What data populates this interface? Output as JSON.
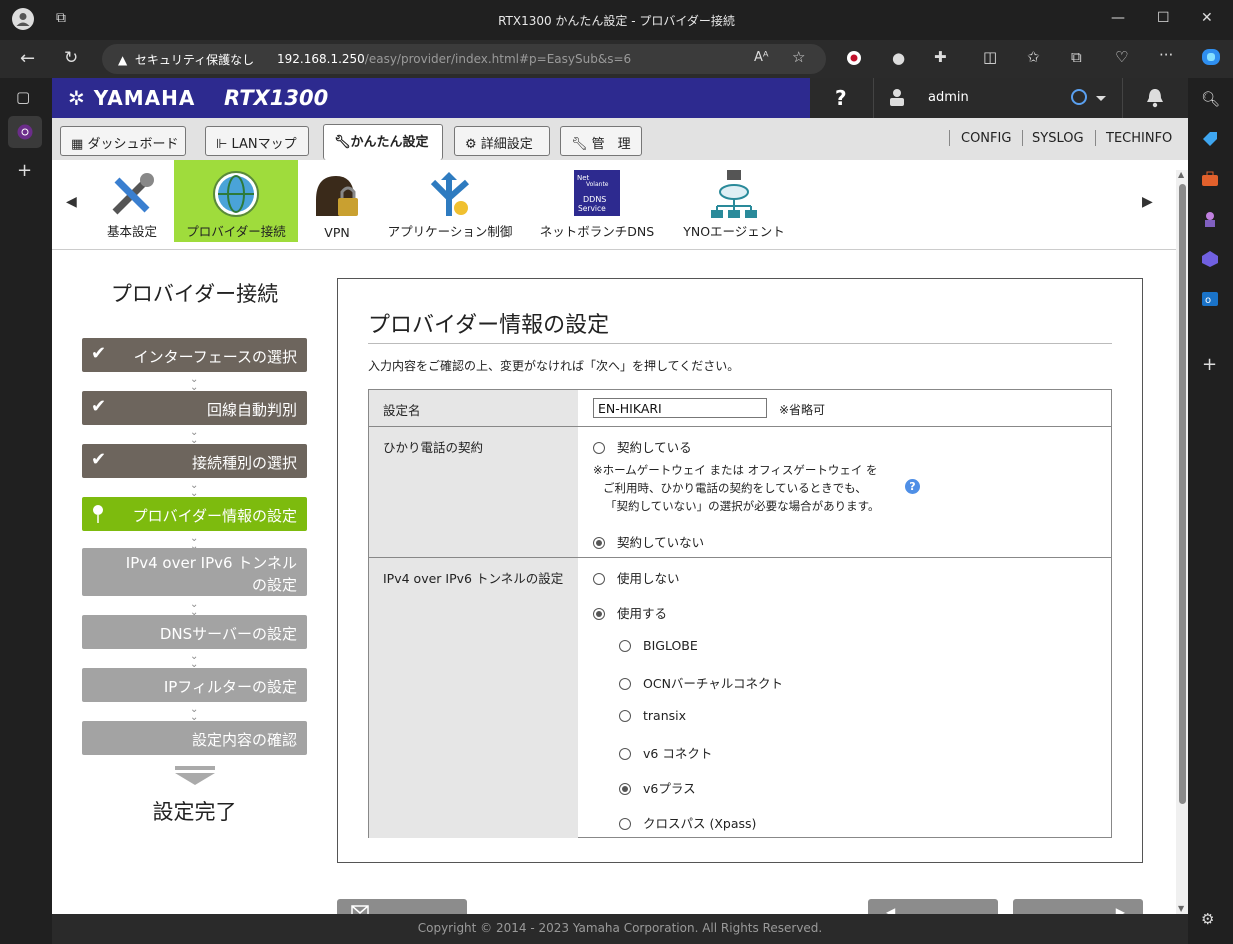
{
  "window": {
    "title": "RTX1300 かんたん設定 - プロバイダー接続"
  },
  "addressbar": {
    "security_warning": "セキュリティ保護なし",
    "url_host": "192.168.1.250",
    "url_path": "/easy/provider/index.html#p=EasySub&s=6"
  },
  "header": {
    "logo": "YAMAHA",
    "model": "RTX1300",
    "help_label": "?",
    "user": "admin"
  },
  "tabs": [
    {
      "label": "ダッシュボード"
    },
    {
      "label": "LANマップ"
    },
    {
      "label": "かんたん設定"
    },
    {
      "label": "詳細設定"
    },
    {
      "label": "管　理"
    }
  ],
  "toplinks": [
    "CONFIG",
    "SYSLOG",
    "TECHINFO"
  ],
  "functions": [
    {
      "label": "基本設定"
    },
    {
      "label": "プロバイダー接続"
    },
    {
      "label": "VPN"
    },
    {
      "label": "アプリケーション制御"
    },
    {
      "label": "ネットボランチDNS"
    },
    {
      "label": "YNOエージェント"
    }
  ],
  "ddns_icon_text": [
    "Net",
    "Volante",
    "DDNS",
    "Service"
  ],
  "sidebar": {
    "title": "プロバイダー接続",
    "steps": [
      {
        "label": "インターフェースの選択",
        "state": "done"
      },
      {
        "label": "回線自動判別",
        "state": "done"
      },
      {
        "label": "接続種別の選択",
        "state": "done"
      },
      {
        "label": "プロバイダー情報の設定",
        "state": "current"
      },
      {
        "label": "IPv4 over IPv6 トンネル",
        "label2": "の設定",
        "state": "todo"
      },
      {
        "label": "DNSサーバーの設定",
        "state": "todo"
      },
      {
        "label": "IPフィルターの設定",
        "state": "todo"
      },
      {
        "label": "設定内容の確認",
        "state": "todo"
      }
    ],
    "complete_label": "設定完了"
  },
  "panel": {
    "title": "プロバイダー情報の設定",
    "description": "入力内容をご確認の上、変更がなければ「次へ」を押してください。",
    "rows": {
      "name": {
        "label": "設定名",
        "value": "EN-HIKARI",
        "hint": "※省略可"
      },
      "hikari": {
        "label": "ひかり電話の契約",
        "opt_yes": "契約している",
        "note1": "※ホームゲートウェイ または オフィスゲートウェイ を",
        "note2": "ご利用時、ひかり電話の契約をしているときでも、",
        "note3": "「契約していない」の選択が必要な場合があります。",
        "help": "?",
        "opt_no": "契約していない",
        "selected": "opt_no"
      },
      "tunnel": {
        "label": "IPv4 over IPv6 トンネルの設定",
        "opt_off": "使用しない",
        "opt_on": "使用する",
        "selected": "opt_on",
        "providers": [
          "BIGLOBE",
          "OCNバーチャルコネクト",
          "transix",
          "v6 コネクト",
          "v6プラス",
          "クロスパス (Xpass)"
        ],
        "selected_provider": "v6プラス"
      }
    }
  },
  "footer": {
    "copyright": "Copyright © 2014 - 2023 Yamaha Corporation. All Rights Reserved."
  },
  "colors": {
    "header_bg": "#2d2a8f",
    "current_step": "#7dbb0e",
    "done_step": "#6d655d",
    "todo_step": "#a3a3a3",
    "selected_function": "#9fdc3c"
  }
}
